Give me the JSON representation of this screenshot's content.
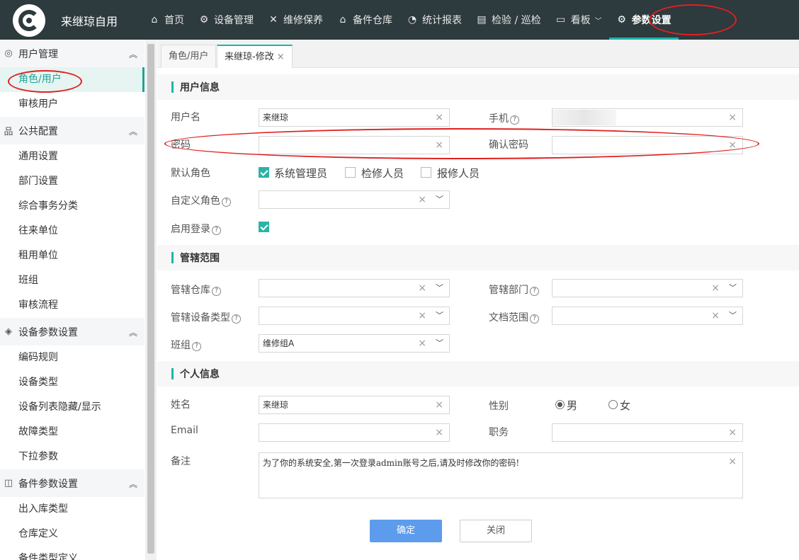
{
  "app": {
    "title": "来继琼自用"
  },
  "nav": [
    {
      "label": "首页",
      "icon": "home-icon"
    },
    {
      "label": "设备管理",
      "icon": "equipment-icon"
    },
    {
      "label": "维修保养",
      "icon": "wrench-icon"
    },
    {
      "label": "备件仓库",
      "icon": "warehouse-icon"
    },
    {
      "label": "统计报表",
      "icon": "pie-chart-icon"
    },
    {
      "label": "检验 / 巡检",
      "icon": "inspection-icon"
    },
    {
      "label": "看板",
      "icon": "board-icon"
    },
    {
      "label": "参数设置",
      "icon": "gear-icon",
      "active": true
    }
  ],
  "sidebar": {
    "groups": [
      {
        "label": "用户管理",
        "icon": "user-circle-icon",
        "items": [
          "角色/用户",
          "审核用户"
        ]
      },
      {
        "label": "公共配置",
        "icon": "hierarchy-icon",
        "items": [
          "通用设置",
          "部门设置",
          "综合事务分类",
          "往来单位",
          "租用单位",
          "班组",
          "审核流程"
        ]
      },
      {
        "label": "设备参数设置",
        "icon": "layers-icon",
        "items": [
          "编码规则",
          "设备类型",
          "设备列表隐藏/显示",
          "故障类型",
          "下拉参数"
        ]
      },
      {
        "label": "备件参数设置",
        "icon": "box-icon",
        "items": [
          "出入库类型",
          "仓库定义",
          "备件类型定义"
        ]
      }
    ]
  },
  "tabs": [
    {
      "label": "角色/用户"
    },
    {
      "label": "来继琼-修改",
      "close": "×"
    }
  ],
  "sections": {
    "user_info": "用户信息",
    "scope": "管辖范围",
    "personal": "个人信息"
  },
  "form": {
    "username_label": "用户名",
    "username_value": "来继琼",
    "phone_label": "手机",
    "password_label": "密码",
    "confirm_password_label": "确认密码",
    "default_role_label": "默认角色",
    "roles": [
      {
        "label": "系统管理员",
        "checked": true
      },
      {
        "label": "检修人员",
        "checked": false
      },
      {
        "label": "报修人员",
        "checked": false
      }
    ],
    "custom_role_label": "自定义角色",
    "enable_login_label": "启用登录",
    "warehouse_label": "管辖仓库",
    "department_label": "管辖部门",
    "equipment_type_label": "管辖设备类型",
    "document_scope_label": "文档范围",
    "team_label": "班组",
    "team_value": "维修组A",
    "name_label": "姓名",
    "name_value": "来继琼",
    "gender_label": "性别",
    "gender_male": "男",
    "gender_female": "女",
    "email_label": "Email",
    "position_label": "职务",
    "remark_label": "备注",
    "remark_value": "为了你的系统安全,第一次登录admin账号之后,请及时修改你的密码!"
  },
  "buttons": {
    "confirm": "确定",
    "close": "关闭"
  },
  "glyphs": {
    "clear": "×",
    "dropdown": "﹀",
    "help": "?"
  },
  "colors": {
    "topbar": "#2d3a3e",
    "accent": "#1fb5a8",
    "primary_button": "#5d9cec",
    "annotation": "#e02020"
  }
}
